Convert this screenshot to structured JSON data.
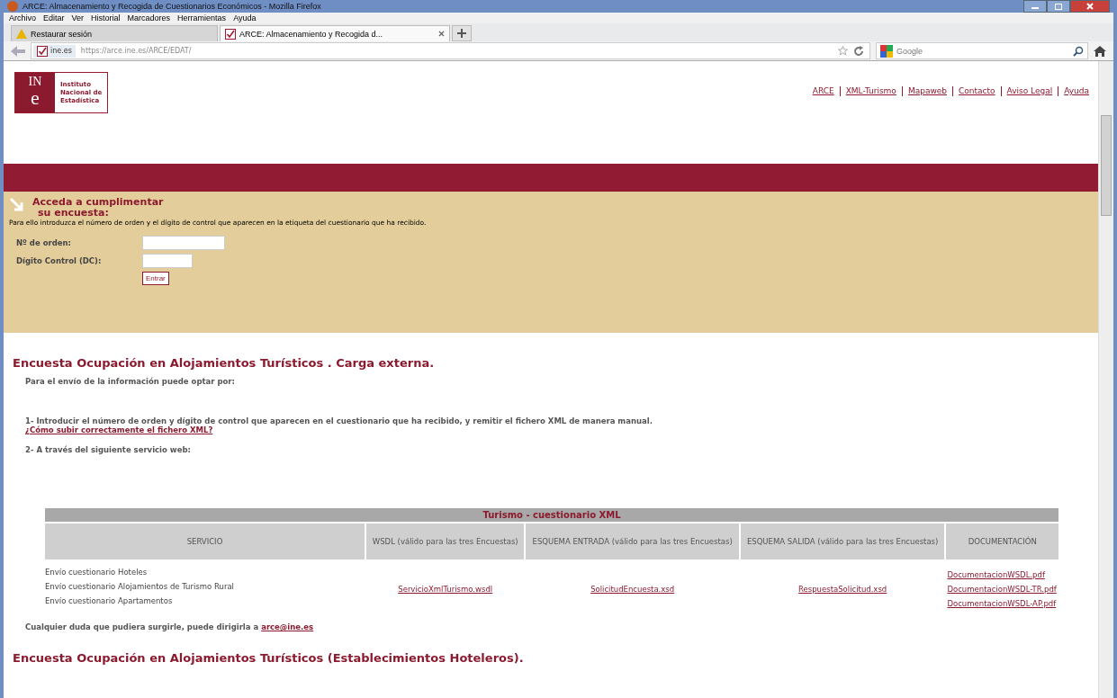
{
  "window": {
    "title": "ARCE: Almacenamiento y Recogida de Cuestionarios Económicos - Mozilla Firefox"
  },
  "menu": [
    "Archivo",
    "Editar",
    "Ver",
    "Historial",
    "Marcadores",
    "Herramientas",
    "Ayuda"
  ],
  "tabs": [
    {
      "label": "Restaurar sesión",
      "selected": false,
      "kind": "warning"
    },
    {
      "label": "ARCE: Almacenamiento y Recogida d...",
      "selected": true,
      "kind": "site"
    }
  ],
  "address": {
    "site": "ine.es",
    "url": "https://arce.ine.es/ARCE/EDAT/"
  },
  "search": {
    "placeholder": "Google"
  },
  "logo": {
    "mark_top": "IN",
    "mark_bottom": "e",
    "lines": [
      "Instituto",
      "Nacional de",
      "Estadística"
    ]
  },
  "nav_links": [
    "ARCE",
    "XML-Turismo",
    "Mapaweb",
    "Contacto",
    "Aviso Legal",
    "Ayuda"
  ],
  "login": {
    "heading": [
      "Acceda a cumplimentar",
      "su encuesta:"
    ],
    "instruction": "Para ello introduzca el número de orden y el dígito de control que aparecen en la etiqueta del cuestionario que ha recibido.",
    "fields": [
      {
        "label": "Nº de orden:",
        "kind": "long"
      },
      {
        "label": "Dígito Control (DC):",
        "kind": "short"
      }
    ],
    "button": "Entrar"
  },
  "section": {
    "heading": "Encuesta Ocupación en Alojamientos Turísticos . Carga externa.",
    "intro": "Para el envío de la información puede optar por:",
    "option_1": "1- Introducir el número de orden y dígito de control que aparecen en el cuestionario que ha recibido, y remitir el fichero XML de manera manual.",
    "option_1_link": "¿Cómo subir correctamente el fichero XML?",
    "option_2": "2- A través del siguiente servicio web:",
    "table": {
      "title": "Turismo - cuestionario XML",
      "columns": [
        "SERVICIO",
        "WSDL (válido para las tres Encuestas)",
        "ESQUEMA ENTRADA (válido para las tres Encuestas)",
        "ESQUEMA SALIDA (válido para las tres Encuestas)",
        "DOCUMENTACIÓN"
      ],
      "services": [
        "Envío cuestionario Hoteles",
        "Envío cuestionario Alojamientos de Turismo Rural",
        "Envío cuestionario Apartamentos"
      ],
      "wsdl": "ServicioXmlTurismo.wsdl",
      "schema_in": "SolicitudEncuesta.xsd",
      "schema_out": "RespuestaSolicitud.xsd",
      "docs": [
        "DocumentacionWSDL.pdf",
        "DocumentacionWSDL-TR.pdf",
        "DocumentacionWSDL-AP.pdf"
      ]
    },
    "contact": {
      "text": "Cualquier duda que pudiera surgirle, puede dirigirla a ",
      "email": "arce@ine.es"
    },
    "next_heading": "Encuesta Ocupación en Alojamientos Turísticos (Establecimientos Hoteleros)."
  }
}
